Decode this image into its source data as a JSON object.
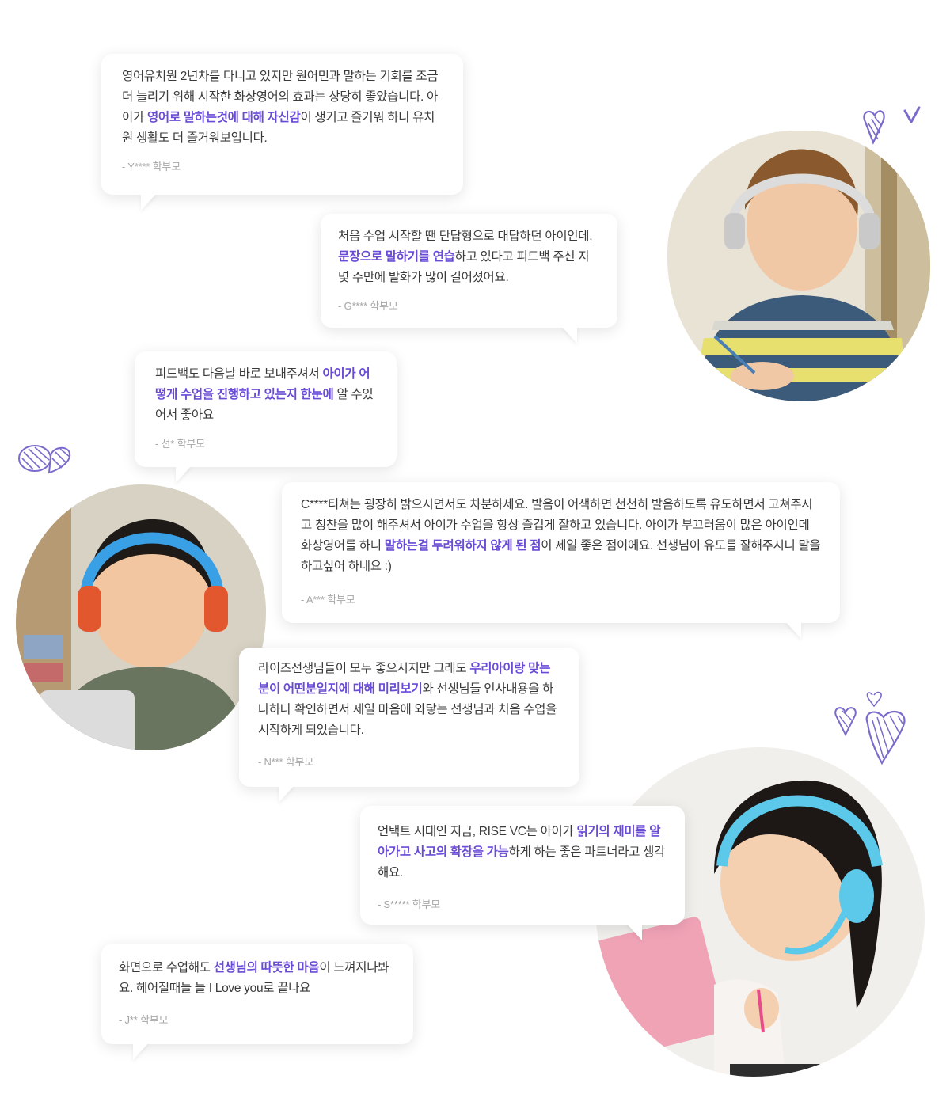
{
  "testimonials": [
    {
      "segments": [
        {
          "t": "영어유치원 2년차를 다니고 있지만 원어민과 말하는 기회를 조금 더 늘리기 위해 시작한 화상영어의 효과는 상당히 좋았습니다. 아이가 ",
          "hl": false
        },
        {
          "t": "영어로 말하는것에 대해 자신감",
          "hl": true
        },
        {
          "t": "이 생기고 즐거워 하니 유치원 생활도 더 즐거워보입니다.",
          "hl": false
        }
      ],
      "author": "- Y**** 학부모"
    },
    {
      "segments": [
        {
          "t": "처음 수업 시작할 땐 단답형으로 대답하던 아이인데, ",
          "hl": false
        },
        {
          "t": "문장으로 말하기를 연습",
          "hl": true
        },
        {
          "t": "하고 있다고 피드백 주신 지 몇 주만에 발화가 많이 길어졌어요.",
          "hl": false
        }
      ],
      "author": "- G**** 학부모"
    },
    {
      "segments": [
        {
          "t": "피드백도 다음날 바로 보내주셔서 ",
          "hl": false
        },
        {
          "t": "아이가 어떻게 수업을 진행하고 있는지 한눈에",
          "hl": true
        },
        {
          "t": " 알 수있어서 좋아요",
          "hl": false
        }
      ],
      "author": "- 선* 학부모"
    },
    {
      "segments": [
        {
          "t": "C****티쳐는 굉장히 밝으시면서도 차분하세요. 발음이 어색하면 천천히 발음하도록 유도하면서 고쳐주시고 칭찬을 많이 해주셔서 아이가 수업을 항상 즐겁게 잘하고 있습니다. 아이가 부끄러움이 많은 아이인데 화상영어를 하니 ",
          "hl": false
        },
        {
          "t": "말하는걸 두려워하지 않게 된 점",
          "hl": true
        },
        {
          "t": "이 제일 좋은 점이에요.  선생님이 유도를 잘해주시니 말을 하고싶어 하네요 :)",
          "hl": false
        }
      ],
      "author": "- A*** 학부모"
    },
    {
      "segments": [
        {
          "t": "라이즈선생님들이 모두 좋으시지만 그래도 ",
          "hl": false
        },
        {
          "t": "우리아이랑 맞는분이 어떤분일지에 대해 미리보기",
          "hl": true
        },
        {
          "t": "와 선생님들 인사내용을 하나하나 확인하면서 제일 마음에 와닿는 선생님과 처음 수업을 시작하게 되었습니다.",
          "hl": false
        }
      ],
      "author": "- N*** 학부모"
    },
    {
      "segments": [
        {
          "t": "언택트 시대인 지금, RISE VC는 아이가 ",
          "hl": false
        },
        {
          "t": "읽기의 재미를 알아가고 사고의 확장을 가능",
          "hl": true
        },
        {
          "t": "하게 하는 좋은 파트너라고 생각해요.",
          "hl": false
        }
      ],
      "author": "- S***** 학부모"
    },
    {
      "segments": [
        {
          "t": "화면으로 수업해도 ",
          "hl": false
        },
        {
          "t": "선생님의 따뜻한 마음",
          "hl": true
        },
        {
          "t": "이 느껴지나봐요. 헤어질때늘 늘 I Love you로 끝나요",
          "hl": false
        }
      ],
      "author": "- J** 학부모"
    }
  ],
  "colors": {
    "highlight": "#6a4bd6",
    "doodle": "#7a6acb"
  }
}
